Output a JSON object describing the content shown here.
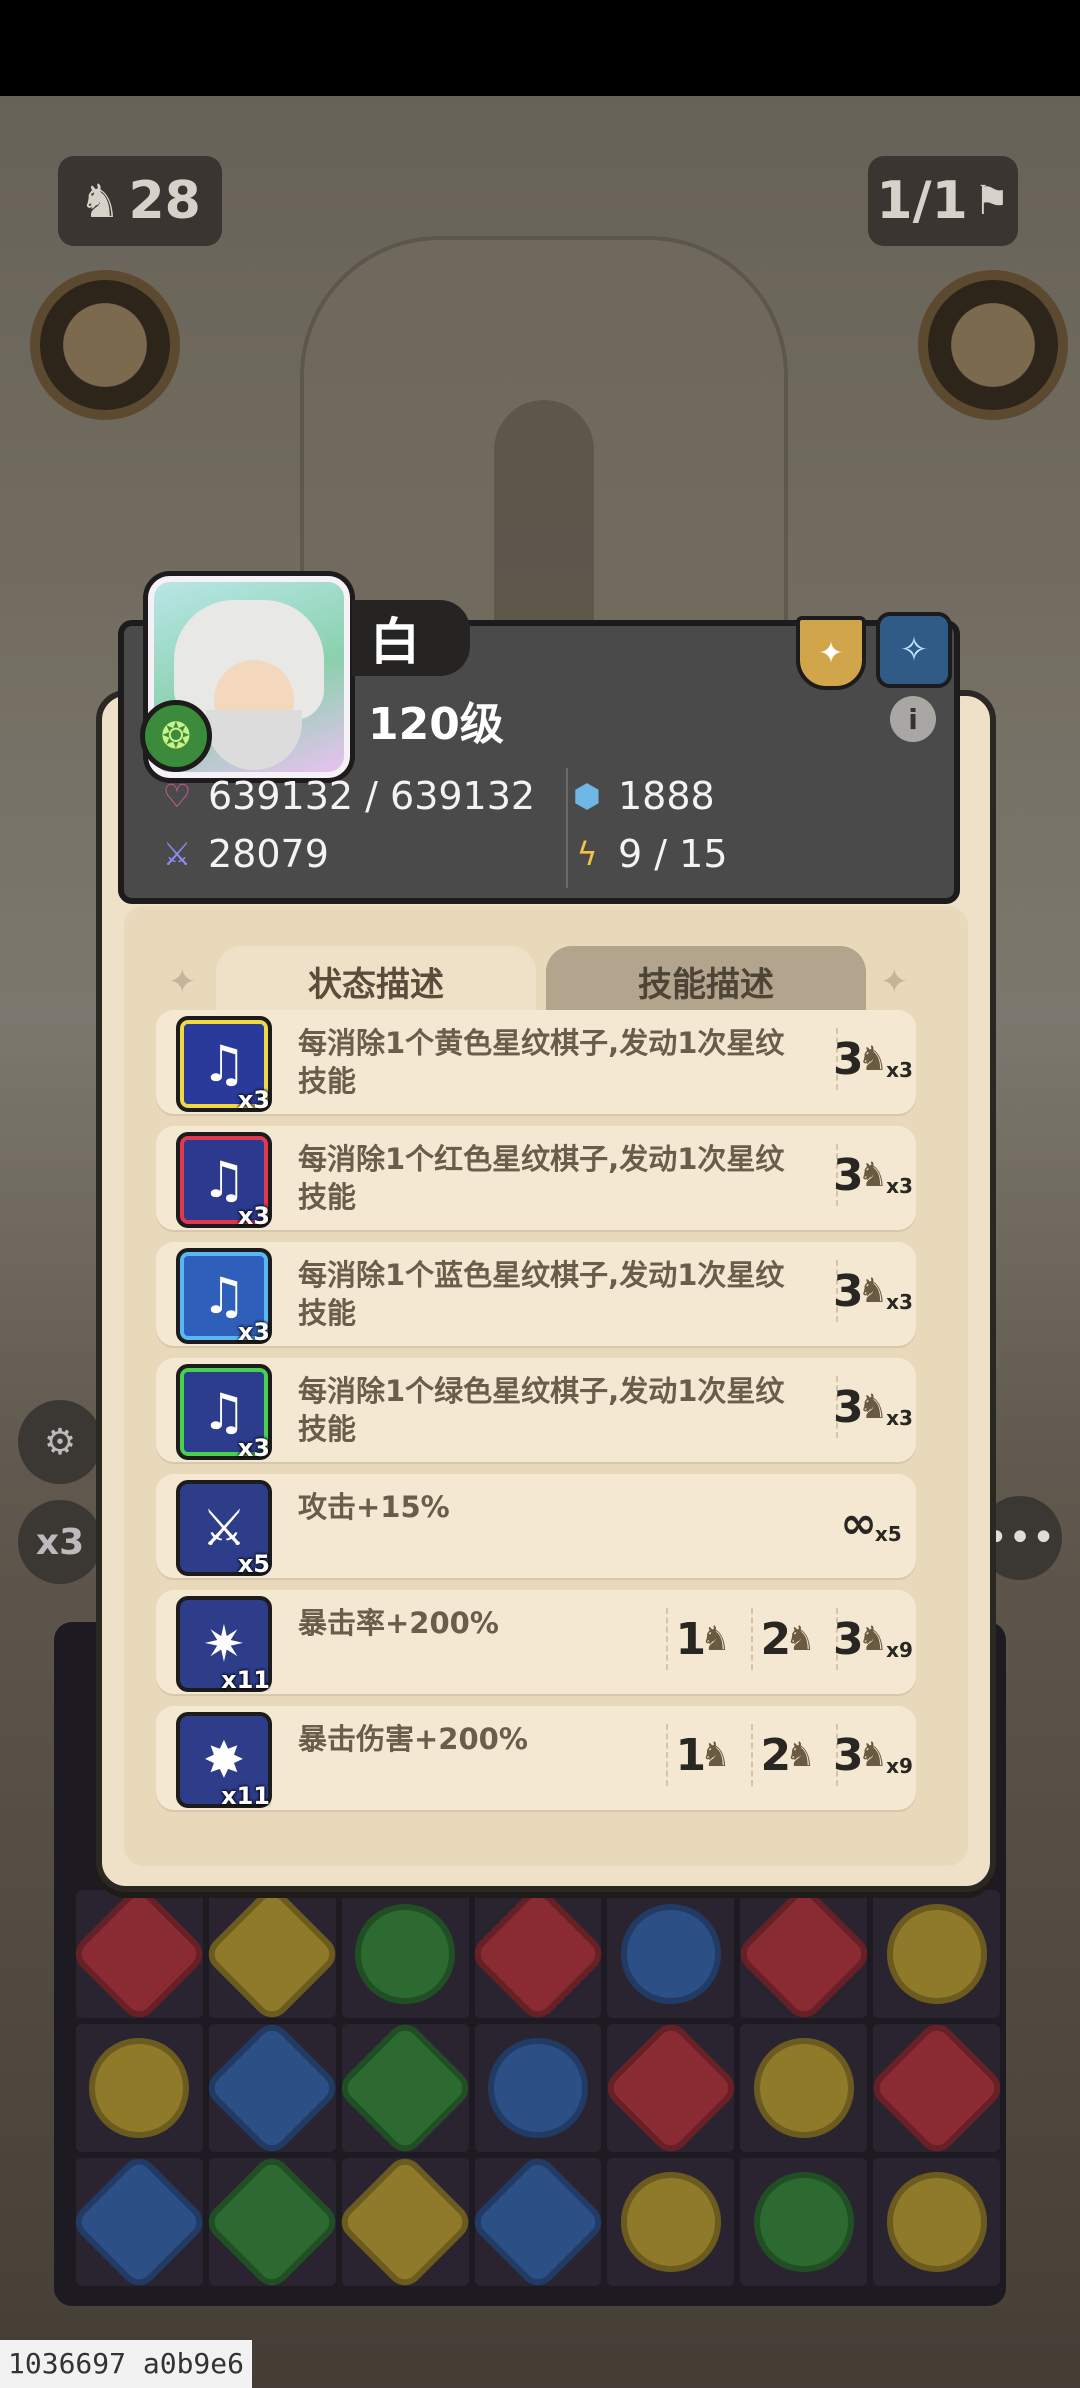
{
  "hud": {
    "turns": "28",
    "wave": "1/1",
    "speed": "x3"
  },
  "hero": {
    "name": "白",
    "level": "120级",
    "hp": "639132 / 639132",
    "defense": "1888",
    "attack": "28079",
    "energy": "9 / 15"
  },
  "tabs": [
    {
      "label": "状态描述",
      "active": true
    },
    {
      "label": "技能描述",
      "active": false
    }
  ],
  "effects": [
    {
      "icon": "music-note-yellow-icon",
      "color": "#f1d840",
      "count": "x3",
      "text": "每消除1个黄色星纹棋子,发动1次星纹技能",
      "reqs": [
        {
          "num": "3",
          "mult": "x3"
        }
      ]
    },
    {
      "icon": "music-note-red-icon",
      "color": "#e0384f",
      "count": "x3",
      "text": "每消除1个红色星纹棋子,发动1次星纹技能",
      "reqs": [
        {
          "num": "3",
          "mult": "x3"
        }
      ]
    },
    {
      "icon": "music-note-blue-icon",
      "color": "#58b8f3",
      "count": "x3",
      "text": "每消除1个蓝色星纹棋子,发动1次星纹技能",
      "reqs": [
        {
          "num": "3",
          "mult": "x3"
        }
      ]
    },
    {
      "icon": "music-note-green-icon",
      "color": "#46d24d",
      "count": "x3",
      "text": "每消除1个绿色星纹棋子,发动1次星纹技能",
      "reqs": [
        {
          "num": "3",
          "mult": "x3"
        }
      ]
    },
    {
      "icon": "sword-icon",
      "color": "#2d3d8a",
      "count": "x5",
      "text": "攻击+15%",
      "reqs": [
        {
          "num": "∞",
          "mult": "x5"
        }
      ]
    },
    {
      "icon": "crit-rate-icon",
      "color": "#2d3d8a",
      "count": "x11",
      "text": "暴击率+200%",
      "reqs": [
        {
          "num": "1",
          "mult": ""
        },
        {
          "num": "2",
          "mult": ""
        },
        {
          "num": "3",
          "mult": "x9"
        }
      ]
    },
    {
      "icon": "crit-damage-icon",
      "color": "#2d3d8a",
      "count": "x11",
      "text": "暴击伤害+200%",
      "reqs": [
        {
          "num": "1",
          "mult": ""
        },
        {
          "num": "2",
          "mult": ""
        },
        {
          "num": "3",
          "mult": "x9"
        }
      ]
    }
  ],
  "watermark": "1036697 a0b9e6"
}
